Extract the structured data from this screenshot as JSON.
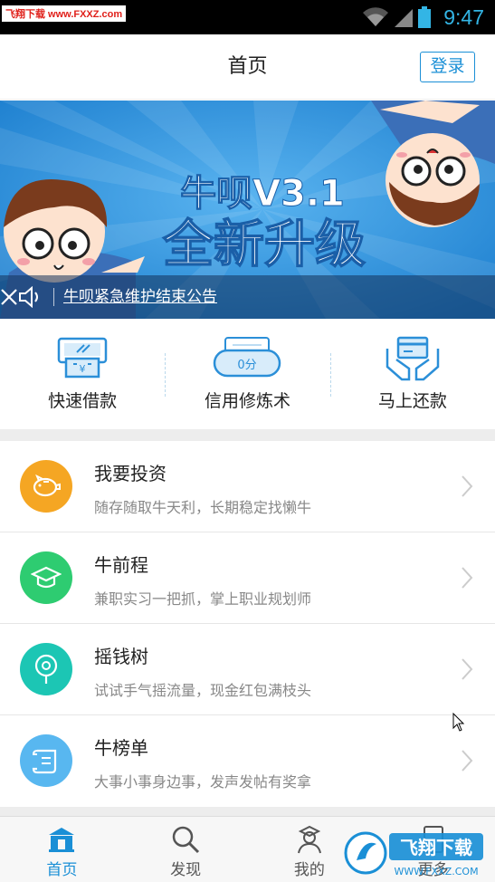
{
  "status_bar": {
    "watermark": "飞翔下载 www.FXXZ.com",
    "time": "9:47"
  },
  "header": {
    "title": "首页",
    "login_label": "登录"
  },
  "banner": {
    "title_line1": "牛呗V3.1",
    "title_line2": "全新升级",
    "notice_text": "牛呗紧急维护结束公告"
  },
  "quick_actions": [
    {
      "label": "快速借款",
      "icon": "atm-cash-icon"
    },
    {
      "label": "信用修炼术",
      "icon": "credit-score-icon",
      "badge": "0分"
    },
    {
      "label": "马上还款",
      "icon": "hands-card-icon"
    }
  ],
  "list": [
    {
      "title": "我要投资",
      "subtitle": "随存随取牛天利，长期稳定找懒牛",
      "icon": "piggy-bank-icon",
      "color": "#f5a623"
    },
    {
      "title": "牛前程",
      "subtitle": "兼职实习一把抓，掌上职业规划师",
      "icon": "graduation-cap-icon",
      "color": "#2ecc71"
    },
    {
      "title": "摇钱树",
      "subtitle": "试试手气摇流量，现金红包满枝头",
      "icon": "money-tree-icon",
      "color": "#1cc6b4"
    },
    {
      "title": "牛榜单",
      "subtitle": "大事小事身边事，发声发帖有奖拿",
      "icon": "scroll-icon",
      "color": "#58b7f0"
    }
  ],
  "bottom_nav": [
    {
      "label": "首页",
      "icon": "home-icon",
      "active": true
    },
    {
      "label": "发现",
      "icon": "search-icon",
      "active": false
    },
    {
      "label": "我的",
      "icon": "user-icon",
      "active": false
    },
    {
      "label": "更多",
      "icon": "more-icon",
      "active": false
    }
  ],
  "colors": {
    "accent": "#1a8fd6",
    "banner_bg": "#2c8fdc"
  },
  "overlay_watermark": {
    "text": "飞翔下载",
    "url": "WWW.FXXZ.COM"
  }
}
